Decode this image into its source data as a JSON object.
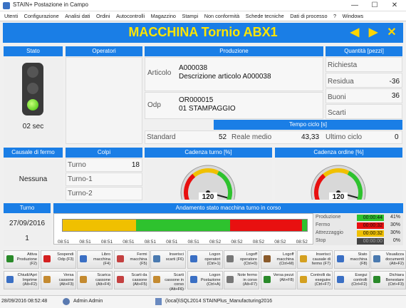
{
  "window": {
    "title": "STAIN+ Postazione in Campo",
    "minimize": "—",
    "maximize": "☐",
    "close": "✕"
  },
  "menu": [
    "Utenti",
    "Configurazione",
    "Analisi dati",
    "Ordini",
    "Autocontrolli",
    "Magazzino",
    "Stampi",
    "Non conformità",
    "Schede tecniche",
    "Dati di processo",
    "?",
    "Windows"
  ],
  "machine": {
    "title": "MACCHINA Tornio ABX1",
    "prev": "◀",
    "next": "▶",
    "close": "✕"
  },
  "stato": {
    "header": "Stato",
    "time": "02 sec"
  },
  "operatori": {
    "header": "Operatori"
  },
  "produzione": {
    "header": "Produzione",
    "articolo_label": "Articolo",
    "articolo_code": "A000038",
    "articolo_desc": "Descrizione articolo A000038",
    "odp_label": "Odp",
    "odp_code": "OR000015",
    "odp_desc": "01 STAMPAGGIO"
  },
  "quantita": {
    "header": "Quantità [pezzi]",
    "richiesta_label": "Richiesta",
    "richiesta": "",
    "residua_label": "Residua",
    "residua": "-36",
    "buoni_label": "Buoni",
    "buoni": "36",
    "scarti_label": "Scarti",
    "scarti": ""
  },
  "tempo_ciclo": {
    "header": "Tempo ciclo [s]",
    "standard_label": "Standard",
    "standard": "52",
    "reale_label": "Reale medio",
    "reale": "43,33",
    "ultimo_label": "Ultimo ciclo",
    "ultimo": "0"
  },
  "causale": {
    "header": "Causale di fermo",
    "value": "Nessuna"
  },
  "colpi": {
    "header": "Colpi",
    "turno1_label": "Turno",
    "turno1": "18",
    "turno2_label": "Turno-1",
    "turno3_label": "Turno-2"
  },
  "cadenza_turno": {
    "header": "Cadenza turno [%]",
    "value": "120",
    "gauge_fraction": 0.95
  },
  "cadenza_ordine": {
    "header": "Cadenza ordine [%]",
    "value": "120",
    "gauge_fraction": 0.95
  },
  "turno": {
    "header": "Turno",
    "date": "27/09/2016",
    "number": "1"
  },
  "andamento": {
    "header": "Andamento stato macchina turno in corso",
    "time_labels": [
      "08:51",
      "08:51",
      "08:51",
      "08:51",
      "08:51",
      "08:51",
      "08:51",
      "08:52",
      "08:52",
      "08:52",
      "08:52",
      "08:52"
    ],
    "segments": [
      {
        "state": "Attesa",
        "fraction": 0.3,
        "color": "#f0c000"
      },
      {
        "state": "Produzione",
        "fraction": 0.385,
        "color": "#2ec22e"
      },
      {
        "state": "Fermo",
        "fraction": 0.295,
        "color": "#e81010"
      },
      {
        "state": "Produzione",
        "fraction": 0.02,
        "color": "#2ec22e"
      }
    ]
  },
  "legenda": [
    {
      "label": "Produzione",
      "time": "00:00:44",
      "percent": "41%",
      "color": "#2ec22e"
    },
    {
      "label": "Fermo",
      "time": "00:00:32",
      "percent": "30%",
      "color": "#e81010"
    },
    {
      "label": "Attrezzaggio",
      "time": "00:00:32",
      "percent": "30%",
      "color": "#f0c000"
    },
    {
      "label": "Stop",
      "time": "00:00:00",
      "percent": "0%",
      "color": "#444444"
    }
  ],
  "buttons_row1": [
    {
      "label": "Attiva Produzione (F2)",
      "icon": "play-icon",
      "color": "#2a8a2a"
    },
    {
      "label": "Sospendi Odp (F3)",
      "icon": "pause-icon",
      "color": "#d42020"
    },
    {
      "label": "Libro macchina (F4)",
      "icon": "book-icon",
      "color": "#3a6fc4"
    },
    {
      "label": "Fermi macchina (F5)",
      "icon": "stop-icon",
      "color": "#c44040"
    },
    {
      "label": "Inserisci scarti (F6)",
      "icon": "edit-icon",
      "color": "#4a7ab0"
    },
    {
      "label": "Logon operatori (Ctrl+1)",
      "icon": "user-icon",
      "color": "#3a6fc4"
    },
    {
      "label": "Logoff operatore (Ctrl+0)",
      "icon": "logout-icon",
      "color": "#777777"
    },
    {
      "label": "Logoff macchina (Ctrl+M)",
      "icon": "machine-icon",
      "color": "#8a5a2a"
    },
    {
      "label": "Inserisci causale di fermo (F7)",
      "icon": "warning-icon",
      "color": "#d4a020"
    },
    {
      "label": "Stato macchina (F8)",
      "icon": "info-icon",
      "color": "#3a6fc4"
    },
    {
      "label": "Visualizza documenti (Alt+F2)",
      "icon": "document-icon",
      "color": "#4a7ab0"
    }
  ],
  "buttons_row2": [
    {
      "label": "Chiudi/Apri Imprime (Alt+F2)",
      "icon": "arrow-icon",
      "color": "#3a6fc4"
    },
    {
      "label": "Versa cassone (Alt+F3)",
      "icon": "box-icon",
      "color": "#c48a30"
    },
    {
      "label": "Scarica cassone (Alt+F4)",
      "icon": "unload-icon",
      "color": "#c48a30"
    },
    {
      "label": "Scarti da cassone (Alt+F5)",
      "icon": "trash-icon",
      "color": "#c44040"
    },
    {
      "label": "Scarti cassone in corso (Alt+F6)",
      "icon": "crate-icon",
      "color": "#c48a30"
    },
    {
      "label": "Logon Postazione (Ctrl+A)",
      "icon": "workstation-icon",
      "color": "#3a6fc4"
    },
    {
      "label": "Note fermo in corso (Alt+F7)",
      "icon": "note-icon",
      "color": "#777777"
    },
    {
      "label": "Versa pezzi (Alt+F8)",
      "icon": "pieces-icon",
      "color": "#2a8a2a"
    },
    {
      "label": "Controlli da eseguire (Ctrl+F7)",
      "icon": "check-icon",
      "color": "#d4a020"
    },
    {
      "label": "Esegui controlli (Ctrl+F2)",
      "icon": "magnifier-icon",
      "color": "#3a6fc4"
    },
    {
      "label": "Dichiara Benestare (Ctrl+F3)",
      "icon": "approve-icon",
      "color": "#2a8a2a"
    }
  ],
  "status": {
    "datetime": "28/09/2016 08:52:48",
    "user": "Admin Admin",
    "db": "(local)\\SQL2014 STAINPlus_Manufacturing2016"
  }
}
